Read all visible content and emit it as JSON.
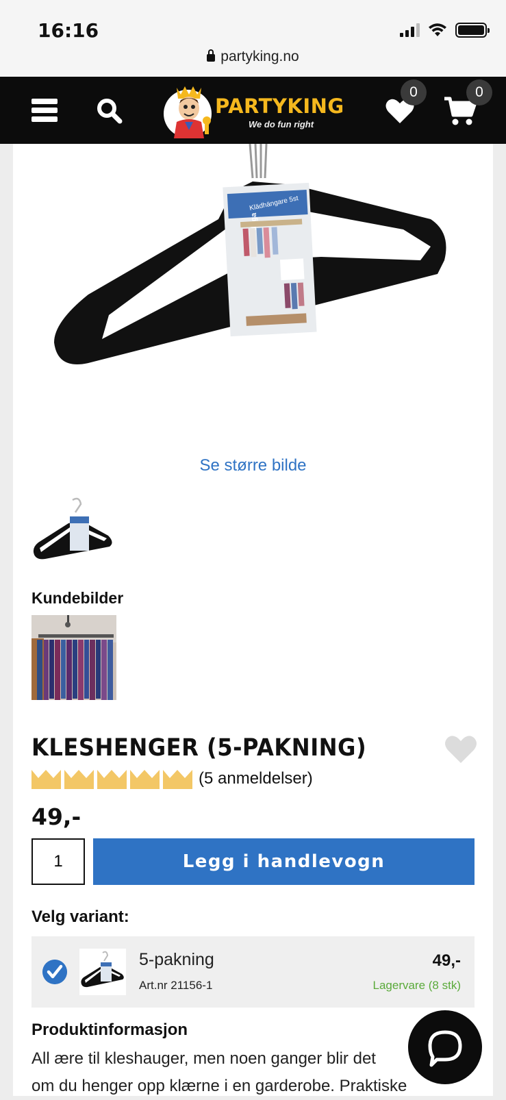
{
  "status": {
    "time": "16:16",
    "url": "partyking.no"
  },
  "nav": {
    "brand": "PARTYKING",
    "tagline": "We do fun right",
    "wishlist_count": "0",
    "cart_count": "0"
  },
  "gallery": {
    "see_larger": "Se større bilde",
    "package_text": "Klädhängare 5st",
    "package_brand": "duga",
    "customer_images_title": "Kundebilder"
  },
  "product": {
    "title": "KLESHENGER (5-PAKNING)",
    "rating_stars": 5,
    "rating_max": 5,
    "reviews": "(5 anmeldelser)",
    "price": "49,-",
    "quantity": "1",
    "add_to_cart_label": "Legg i handlevogn"
  },
  "variant": {
    "title": "Velg variant:",
    "name": "5-pakning",
    "art_nr": "Art.nr 21156-1",
    "price": "49,-",
    "stock": "Lagervare (8 stk)"
  },
  "info": {
    "title": "Produktinformasjon",
    "line1": "All ære til kleshauger, men noen ganger blir det",
    "line2": "om du henger opp klærne i en garderobe. Praktiske"
  },
  "colors": {
    "accent": "#2f73c4",
    "logo_yellow": "#f5b81e",
    "nav_bg": "#0c0c0c",
    "stock_green": "#5aaa3a"
  },
  "icons": [
    "menu-icon",
    "search-icon",
    "heart-icon",
    "cart-icon",
    "crown-icon",
    "check-icon",
    "chat-icon"
  ]
}
